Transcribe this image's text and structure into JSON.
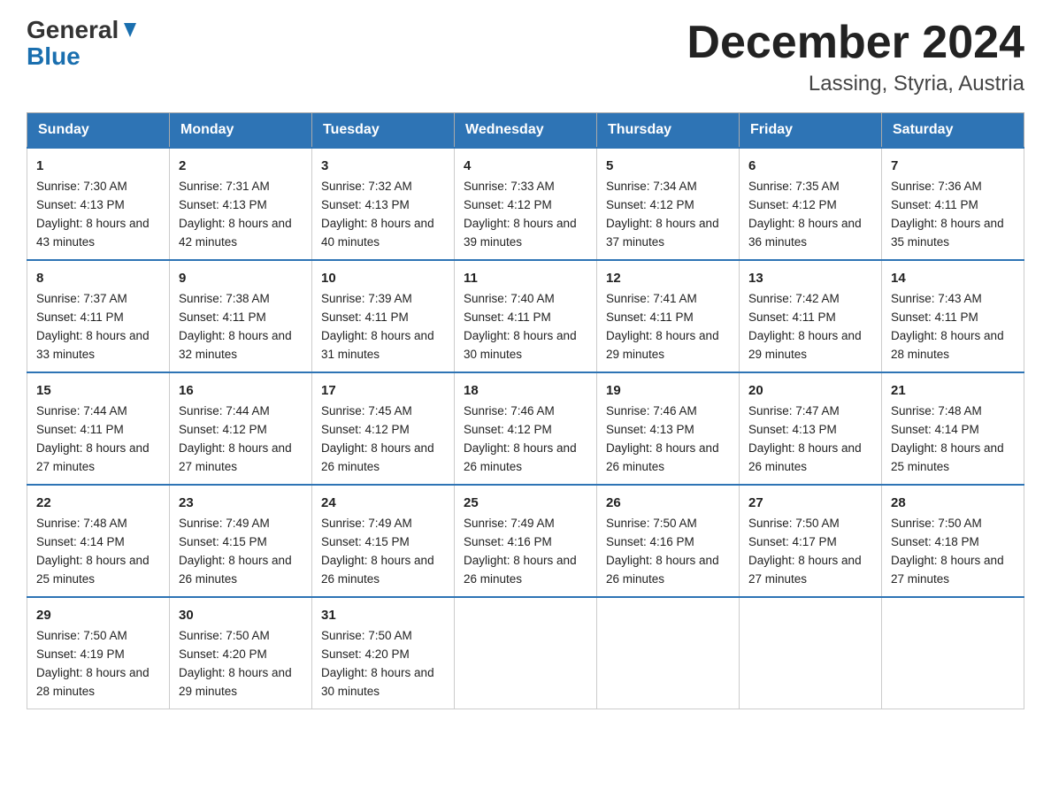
{
  "logo": {
    "text1": "General",
    "text2": "Blue"
  },
  "title": "December 2024",
  "subtitle": "Lassing, Styria, Austria",
  "days_of_week": [
    "Sunday",
    "Monday",
    "Tuesday",
    "Wednesday",
    "Thursday",
    "Friday",
    "Saturday"
  ],
  "weeks": [
    [
      {
        "day": "1",
        "sunrise": "7:30 AM",
        "sunset": "4:13 PM",
        "daylight": "8 hours and 43 minutes."
      },
      {
        "day": "2",
        "sunrise": "7:31 AM",
        "sunset": "4:13 PM",
        "daylight": "8 hours and 42 minutes."
      },
      {
        "day": "3",
        "sunrise": "7:32 AM",
        "sunset": "4:13 PM",
        "daylight": "8 hours and 40 minutes."
      },
      {
        "day": "4",
        "sunrise": "7:33 AM",
        "sunset": "4:12 PM",
        "daylight": "8 hours and 39 minutes."
      },
      {
        "day": "5",
        "sunrise": "7:34 AM",
        "sunset": "4:12 PM",
        "daylight": "8 hours and 37 minutes."
      },
      {
        "day": "6",
        "sunrise": "7:35 AM",
        "sunset": "4:12 PM",
        "daylight": "8 hours and 36 minutes."
      },
      {
        "day": "7",
        "sunrise": "7:36 AM",
        "sunset": "4:11 PM",
        "daylight": "8 hours and 35 minutes."
      }
    ],
    [
      {
        "day": "8",
        "sunrise": "7:37 AM",
        "sunset": "4:11 PM",
        "daylight": "8 hours and 33 minutes."
      },
      {
        "day": "9",
        "sunrise": "7:38 AM",
        "sunset": "4:11 PM",
        "daylight": "8 hours and 32 minutes."
      },
      {
        "day": "10",
        "sunrise": "7:39 AM",
        "sunset": "4:11 PM",
        "daylight": "8 hours and 31 minutes."
      },
      {
        "day": "11",
        "sunrise": "7:40 AM",
        "sunset": "4:11 PM",
        "daylight": "8 hours and 30 minutes."
      },
      {
        "day": "12",
        "sunrise": "7:41 AM",
        "sunset": "4:11 PM",
        "daylight": "8 hours and 29 minutes."
      },
      {
        "day": "13",
        "sunrise": "7:42 AM",
        "sunset": "4:11 PM",
        "daylight": "8 hours and 29 minutes."
      },
      {
        "day": "14",
        "sunrise": "7:43 AM",
        "sunset": "4:11 PM",
        "daylight": "8 hours and 28 minutes."
      }
    ],
    [
      {
        "day": "15",
        "sunrise": "7:44 AM",
        "sunset": "4:11 PM",
        "daylight": "8 hours and 27 minutes."
      },
      {
        "day": "16",
        "sunrise": "7:44 AM",
        "sunset": "4:12 PM",
        "daylight": "8 hours and 27 minutes."
      },
      {
        "day": "17",
        "sunrise": "7:45 AM",
        "sunset": "4:12 PM",
        "daylight": "8 hours and 26 minutes."
      },
      {
        "day": "18",
        "sunrise": "7:46 AM",
        "sunset": "4:12 PM",
        "daylight": "8 hours and 26 minutes."
      },
      {
        "day": "19",
        "sunrise": "7:46 AM",
        "sunset": "4:13 PM",
        "daylight": "8 hours and 26 minutes."
      },
      {
        "day": "20",
        "sunrise": "7:47 AM",
        "sunset": "4:13 PM",
        "daylight": "8 hours and 26 minutes."
      },
      {
        "day": "21",
        "sunrise": "7:48 AM",
        "sunset": "4:14 PM",
        "daylight": "8 hours and 25 minutes."
      }
    ],
    [
      {
        "day": "22",
        "sunrise": "7:48 AM",
        "sunset": "4:14 PM",
        "daylight": "8 hours and 25 minutes."
      },
      {
        "day": "23",
        "sunrise": "7:49 AM",
        "sunset": "4:15 PM",
        "daylight": "8 hours and 26 minutes."
      },
      {
        "day": "24",
        "sunrise": "7:49 AM",
        "sunset": "4:15 PM",
        "daylight": "8 hours and 26 minutes."
      },
      {
        "day": "25",
        "sunrise": "7:49 AM",
        "sunset": "4:16 PM",
        "daylight": "8 hours and 26 minutes."
      },
      {
        "day": "26",
        "sunrise": "7:50 AM",
        "sunset": "4:16 PM",
        "daylight": "8 hours and 26 minutes."
      },
      {
        "day": "27",
        "sunrise": "7:50 AM",
        "sunset": "4:17 PM",
        "daylight": "8 hours and 27 minutes."
      },
      {
        "day": "28",
        "sunrise": "7:50 AM",
        "sunset": "4:18 PM",
        "daylight": "8 hours and 27 minutes."
      }
    ],
    [
      {
        "day": "29",
        "sunrise": "7:50 AM",
        "sunset": "4:19 PM",
        "daylight": "8 hours and 28 minutes."
      },
      {
        "day": "30",
        "sunrise": "7:50 AM",
        "sunset": "4:20 PM",
        "daylight": "8 hours and 29 minutes."
      },
      {
        "day": "31",
        "sunrise": "7:50 AM",
        "sunset": "4:20 PM",
        "daylight": "8 hours and 30 minutes."
      },
      null,
      null,
      null,
      null
    ]
  ]
}
